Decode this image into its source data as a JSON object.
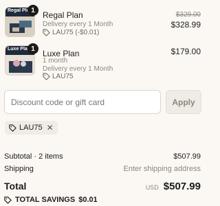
{
  "items": [
    {
      "name": "Regal Plan",
      "thumb_label": "Regal Pla",
      "quantity": "1",
      "delivery": "Delivery every 1 Month",
      "discount": "LAU75 (-$0.01)",
      "original_price": "$329.00",
      "price": "$328.99"
    },
    {
      "name": "Luxe Plan",
      "thumb_label": "Luxe Pla",
      "quantity": "1",
      "duration": "1 month",
      "delivery": "Delivery every 1 Month",
      "discount": "LAU75",
      "price": "$179.00"
    }
  ],
  "discount": {
    "placeholder": "Discount code or gift card",
    "value": "",
    "apply_label": "Apply",
    "applied_code": "LAU75"
  },
  "summary": {
    "subtotal_label": "Subtotal · 2 items",
    "subtotal_value": "$507.99",
    "shipping_label": "Shipping",
    "shipping_value": "Enter shipping address",
    "total_label": "Total",
    "currency": "USD",
    "total_value": "$507.99",
    "savings_label": "TOTAL SAVINGS",
    "savings_value": "$0.01"
  },
  "colors": {
    "background": "#fbf8f3",
    "thumb_band": "#1f2b3a",
    "muted_text": "#8a857f"
  }
}
